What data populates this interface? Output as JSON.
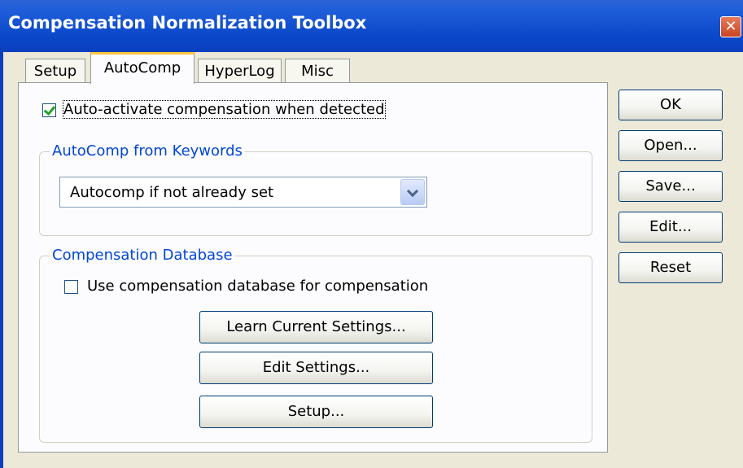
{
  "window": {
    "title": "Compensation Normalization Toolbox",
    "close_glyph": "✕"
  },
  "tabs": [
    {
      "label": "Setup",
      "active": false
    },
    {
      "label": "AutoComp",
      "active": true
    },
    {
      "label": "HyperLog",
      "active": false
    },
    {
      "label": "Misc",
      "active": false
    }
  ],
  "autocomp": {
    "auto_activate_label": "Auto-activate compensation when detected",
    "auto_activate_checked": true,
    "keywords_group_title": "AutoComp from Keywords",
    "keywords_select_value": "Autocomp if not already set",
    "database_group_title": "Compensation Database",
    "use_database_label": "Use compensation database for compensation",
    "use_database_checked": false,
    "learn_button": "Learn Current Settings...",
    "edit_settings_button": "Edit Settings...",
    "setup_button": "Setup..."
  },
  "side_buttons": {
    "ok": "OK",
    "open": "Open...",
    "save": "Save...",
    "edit": "Edit...",
    "reset": "Reset"
  },
  "icons": {
    "close": "close-icon",
    "dropdown": "chevron-down-icon",
    "check": "checkmark-icon"
  },
  "colors": {
    "title_bar": "#0a47c9",
    "group_title": "#0046d5",
    "active_tab_accent": "#ffc83c",
    "check": "#21a121"
  }
}
